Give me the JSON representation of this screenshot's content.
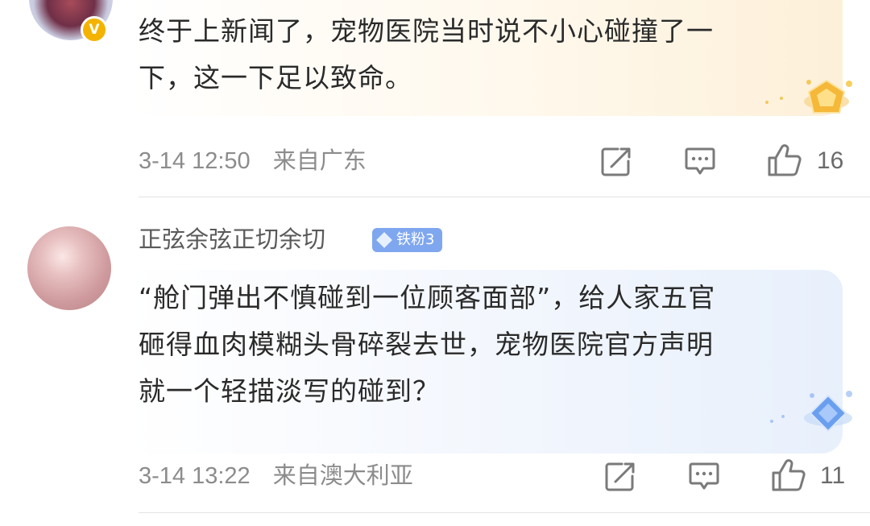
{
  "comments": [
    {
      "avatar_badge": "V",
      "text_lines": [
        "终于上新闻了，宠物医院当时说不小心碰撞了一",
        "下，这一下足以致命。"
      ],
      "timestamp": "3-14 12:50",
      "location": "来自广东",
      "likes": "16",
      "bubble_icon": "gold-badge-icon",
      "bubble_color": "#fdf0d9"
    },
    {
      "username": "正弦余弦正切余切",
      "fan_badge": "铁粉3",
      "text_lines": [
        "“舱门弹出不慎碰到一位顾客面部”，给人家五官",
        "砸得血肉模糊头骨碎裂去世，宠物医院官方声明",
        "就一个轻描淡写的碰到？"
      ],
      "timestamp": "3-14 13:22",
      "location": "来自澳大利亚",
      "likes": "11",
      "bubble_icon": "blue-diamond-badge-icon",
      "bubble_color": "#e8f0fc"
    }
  ],
  "icons": [
    "share-icon",
    "comment-icon",
    "like-icon"
  ],
  "colors": {
    "fan_badge": "#7fa7ef",
    "verified": "#f3b300",
    "meta_text": "#8c8c8c"
  }
}
